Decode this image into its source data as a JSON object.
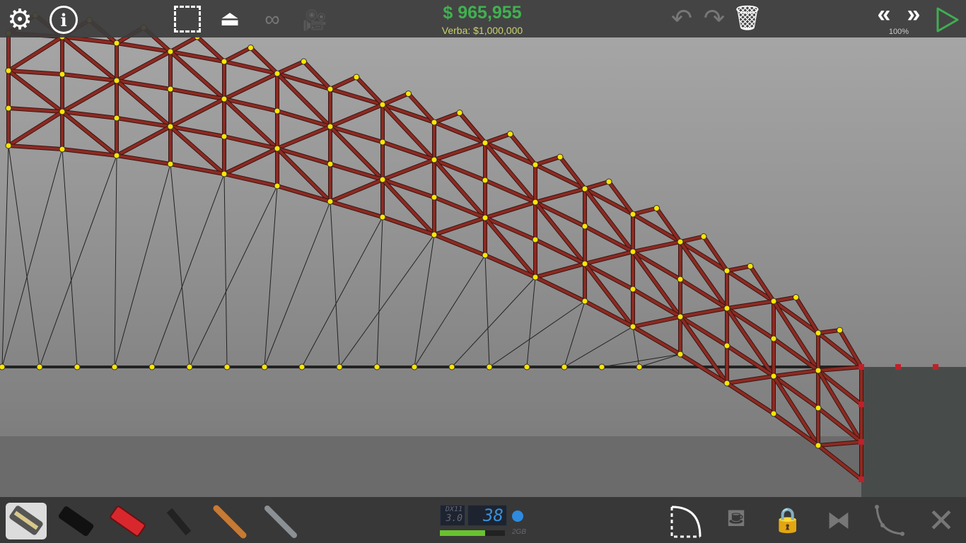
{
  "header": {
    "money": "$ 965,955",
    "budget": "Verba: $1,000,000",
    "speed": "100%"
  },
  "icons": {
    "settings": "gear-icon",
    "info": "info-icon",
    "select": "select-box-icon",
    "weight": "weight-icon",
    "binoculars": "binoculars-icon",
    "camera": "camera-icon",
    "undo": "undo-icon",
    "redo": "redo-icon",
    "delete": "trash-icon",
    "slower": "rewind-icon",
    "faster": "fast-forward-icon",
    "play": "play-icon"
  },
  "materials": [
    "road",
    "reinforced-road",
    "wood",
    "steel",
    "rope",
    "cable"
  ],
  "perf": {
    "api": "DX11",
    "api_ver": "3.0",
    "fps": "38",
    "mem": "2GB",
    "mem_fraction": 0.7
  },
  "tools": [
    "arc-tool",
    "paint-bucket",
    "lock",
    "mirror",
    "spline",
    "close"
  ],
  "colors": {
    "beam": "#8c2a22",
    "node": "#ffe500",
    "money": "#3fb24f",
    "play": "#3fae52"
  }
}
